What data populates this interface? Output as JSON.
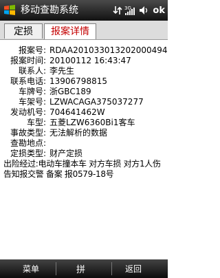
{
  "titlebar": {
    "title": "移动查勘系统",
    "ok_label": "ok",
    "signal_3g_label": "3G"
  },
  "tabs": [
    {
      "label": "定损",
      "active": false
    },
    {
      "label": "报案详情",
      "active": true
    }
  ],
  "details": [
    {
      "label": "报案号:",
      "value": "RDAA201033013202000494"
    },
    {
      "label": "报案时间:",
      "value": "20100112 16:43:47"
    },
    {
      "label": "联系人:",
      "value": "李先生"
    },
    {
      "label": "联系电话:",
      "value": "13906798815"
    },
    {
      "label": "车牌号:",
      "value": "浙GBC189"
    },
    {
      "label": "车架号:",
      "value": "LZWACAGA375037277"
    },
    {
      "label": "发动机号:",
      "value": "704641462W"
    },
    {
      "label": "车型:",
      "value": "五菱LZW6360Bi1客车"
    },
    {
      "label": "事故类型:",
      "value": "无法解析的数据"
    },
    {
      "label": "查勘地点:",
      "value": ""
    },
    {
      "label": "定损类型:",
      "value": "财产定损"
    }
  ],
  "accident_process": {
    "label": "出险经过:",
    "value": "电动车撞本车 对方车损 对方1人伤 告知报交警 备案 报0579-18号"
  },
  "bottombar": {
    "left_label": "菜单",
    "mid_label": "拼",
    "right_label": "返回"
  },
  "colors": {
    "active_tab_text": "#c40000",
    "bar_bg": "#1a1a1a"
  }
}
